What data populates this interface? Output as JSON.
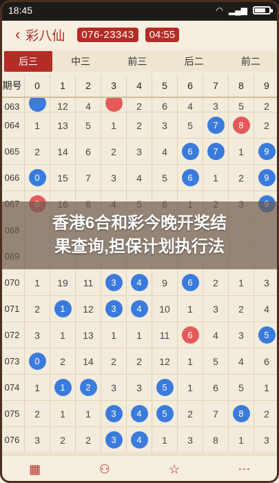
{
  "status_bar": {
    "time": "18:45"
  },
  "header": {
    "back": "‹",
    "title": "彩八仙",
    "issue": "076-23343",
    "countdown": "04:55"
  },
  "tabs": [
    "后三",
    "中三",
    "前三",
    "后二",
    "前二"
  ],
  "columns": {
    "period": "期号",
    "digits": [
      "0",
      "1",
      "2",
      "3",
      "4",
      "5",
      "6",
      "7",
      "8",
      "9"
    ]
  },
  "rows": [
    {
      "period": "063",
      "cells": [
        {
          "b": "blue",
          "v": ""
        },
        {
          "v": "12"
        },
        {
          "v": "4"
        },
        {
          "b": "red",
          "v": ""
        },
        {
          "v": "2"
        },
        {
          "v": "6"
        },
        {
          "v": "4"
        },
        {
          "v": "3"
        },
        {
          "v": "5"
        },
        {
          "v": "2"
        }
      ]
    },
    {
      "period": "064",
      "cells": [
        {
          "v": "1"
        },
        {
          "v": "13"
        },
        {
          "v": "5"
        },
        {
          "v": "1"
        },
        {
          "v": "2"
        },
        {
          "v": "3"
        },
        {
          "v": "5"
        },
        {
          "b": "blue",
          "v": "7"
        },
        {
          "b": "red",
          "v": "8"
        },
        {
          "v": "2"
        }
      ]
    },
    {
      "period": "065",
      "cells": [
        {
          "v": "2"
        },
        {
          "v": "14"
        },
        {
          "v": "6"
        },
        {
          "v": "2"
        },
        {
          "v": "3"
        },
        {
          "v": "4"
        },
        {
          "b": "blue",
          "v": "6"
        },
        {
          "b": "blue",
          "v": "7"
        },
        {
          "v": "1"
        },
        {
          "b": "blue",
          "v": "9"
        }
      ]
    },
    {
      "period": "066",
      "cells": [
        {
          "b": "blue",
          "v": "0"
        },
        {
          "v": "15"
        },
        {
          "v": "7"
        },
        {
          "v": "3"
        },
        {
          "v": "4"
        },
        {
          "v": "5"
        },
        {
          "b": "blue",
          "v": "6"
        },
        {
          "v": "1"
        },
        {
          "v": "2"
        },
        {
          "b": "blue",
          "v": "9"
        }
      ]
    },
    {
      "period": "067",
      "cells": [
        {
          "b": "red",
          "v": "0"
        },
        {
          "v": "16"
        },
        {
          "v": "8"
        },
        {
          "v": "4"
        },
        {
          "v": "5"
        },
        {
          "v": "6"
        },
        {
          "v": "1"
        },
        {
          "v": "2"
        },
        {
          "v": "3"
        },
        {
          "b": "blue",
          "v": "9"
        }
      ]
    },
    {
      "period": "068",
      "cells": [
        {
          "v": ""
        },
        {
          "v": ""
        },
        {
          "v": ""
        },
        {
          "v": ""
        },
        {
          "v": ""
        },
        {
          "v": ""
        },
        {
          "v": ""
        },
        {
          "v": ""
        },
        {
          "v": ""
        },
        {
          "v": ""
        }
      ]
    },
    {
      "period": "069",
      "cells": [
        {
          "v": ""
        },
        {
          "v": ""
        },
        {
          "v": ""
        },
        {
          "v": ""
        },
        {
          "v": ""
        },
        {
          "v": ""
        },
        {
          "v": ""
        },
        {
          "v": ""
        },
        {
          "v": ""
        },
        {
          "v": ""
        }
      ]
    },
    {
      "period": "070",
      "cells": [
        {
          "v": "1"
        },
        {
          "v": "19"
        },
        {
          "v": "11"
        },
        {
          "b": "blue",
          "v": "3"
        },
        {
          "b": "blue",
          "v": "4"
        },
        {
          "v": "9"
        },
        {
          "b": "blue",
          "v": "6"
        },
        {
          "v": "2"
        },
        {
          "v": "1"
        },
        {
          "v": "3"
        }
      ]
    },
    {
      "period": "071",
      "cells": [
        {
          "v": "2"
        },
        {
          "b": "blue",
          "v": "1"
        },
        {
          "v": "12"
        },
        {
          "b": "blue",
          "v": "3"
        },
        {
          "b": "blue",
          "v": "4"
        },
        {
          "v": "10"
        },
        {
          "v": "1"
        },
        {
          "v": "3"
        },
        {
          "v": "2"
        },
        {
          "v": "4"
        }
      ]
    },
    {
      "period": "072",
      "cells": [
        {
          "v": "3"
        },
        {
          "v": "1"
        },
        {
          "v": "13"
        },
        {
          "v": "1"
        },
        {
          "v": "1"
        },
        {
          "v": "11"
        },
        {
          "b": "red",
          "v": "6"
        },
        {
          "v": "4"
        },
        {
          "v": "3"
        },
        {
          "b": "blue",
          "v": "5"
        }
      ]
    },
    {
      "period": "073",
      "cells": [
        {
          "b": "blue",
          "v": "0"
        },
        {
          "v": "2"
        },
        {
          "v": "14"
        },
        {
          "v": "2"
        },
        {
          "v": "2"
        },
        {
          "v": "12"
        },
        {
          "v": "1"
        },
        {
          "v": "5"
        },
        {
          "v": "4"
        },
        {
          "v": "6"
        }
      ]
    },
    {
      "period": "074",
      "cells": [
        {
          "v": "1"
        },
        {
          "b": "blue",
          "v": "1"
        },
        {
          "b": "blue",
          "v": "2"
        },
        {
          "v": "3"
        },
        {
          "v": "3"
        },
        {
          "b": "blue",
          "v": "5"
        },
        {
          "v": "1"
        },
        {
          "v": "6"
        },
        {
          "v": "5"
        },
        {
          "v": "1"
        }
      ]
    },
    {
      "period": "075",
      "cells": [
        {
          "v": "2"
        },
        {
          "v": "1"
        },
        {
          "v": "1"
        },
        {
          "b": "blue",
          "v": "3"
        },
        {
          "b": "blue",
          "v": "4"
        },
        {
          "b": "blue",
          "v": "5"
        },
        {
          "v": "2"
        },
        {
          "v": "7"
        },
        {
          "b": "blue",
          "v": "8"
        },
        {
          "v": "2"
        }
      ]
    },
    {
      "period": "076",
      "cells": [
        {
          "v": "3"
        },
        {
          "v": "2"
        },
        {
          "v": "2"
        },
        {
          "b": "blue",
          "v": "3"
        },
        {
          "b": "blue",
          "v": "4"
        },
        {
          "v": "1"
        },
        {
          "v": "3"
        },
        {
          "v": "8"
        },
        {
          "v": "1"
        },
        {
          "v": "3"
        }
      ]
    }
  ],
  "overlay": {
    "line1": "香港6合和彩今晚开奖结",
    "line2": "果查询,担保计划执行法"
  },
  "bottom_nav": [
    "▦",
    "⚇",
    "☆",
    "⋯"
  ]
}
